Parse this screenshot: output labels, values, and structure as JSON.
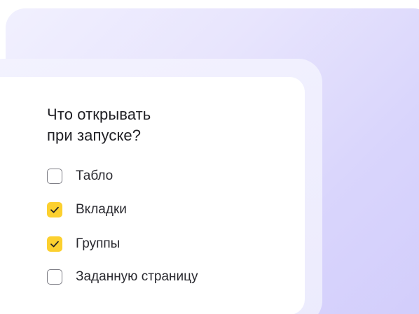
{
  "dialog": {
    "title_line1": "Что открывать",
    "title_line2": "при запуске?"
  },
  "options": [
    {
      "label": "Табло",
      "checked": false
    },
    {
      "label": "Вкладки",
      "checked": true
    },
    {
      "label": "Группы",
      "checked": true
    },
    {
      "label": "Заданную страницу",
      "checked": false
    }
  ],
  "colors": {
    "checkbox_checked_fill": "#fcd02f",
    "checkmark": "#1f1f24",
    "checkbox_border": "#7d7d85",
    "background_tint": "#d9d5fc"
  }
}
